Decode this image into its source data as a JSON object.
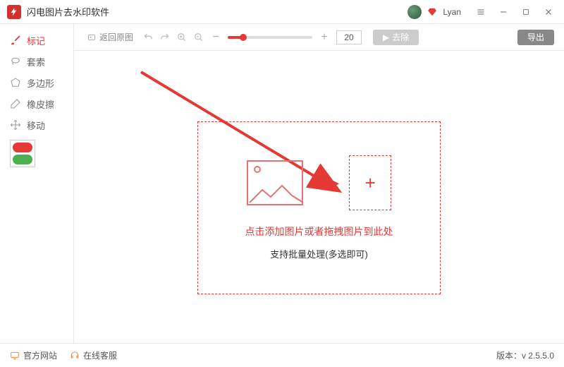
{
  "app": {
    "title": "闪电图片去水印软件"
  },
  "user": {
    "name": "Lyan"
  },
  "tools": {
    "mark": "标记",
    "lasso": "套索",
    "polygon": "多边形",
    "eraser": "橡皮擦",
    "move": "移动"
  },
  "toolbar": {
    "back_original": "返回原图",
    "zoom_value": "20",
    "remove": "去除",
    "export": "导出"
  },
  "dropzone": {
    "line1": "点击添加图片或者拖拽图片到此处",
    "line2": "支持批量处理(多选即可)"
  },
  "footer": {
    "website": "官方网站",
    "support": "在线客服",
    "version_label": "版本：",
    "version_value": "v 2.5.5.0"
  },
  "colors": {
    "accent": "#e53935"
  }
}
